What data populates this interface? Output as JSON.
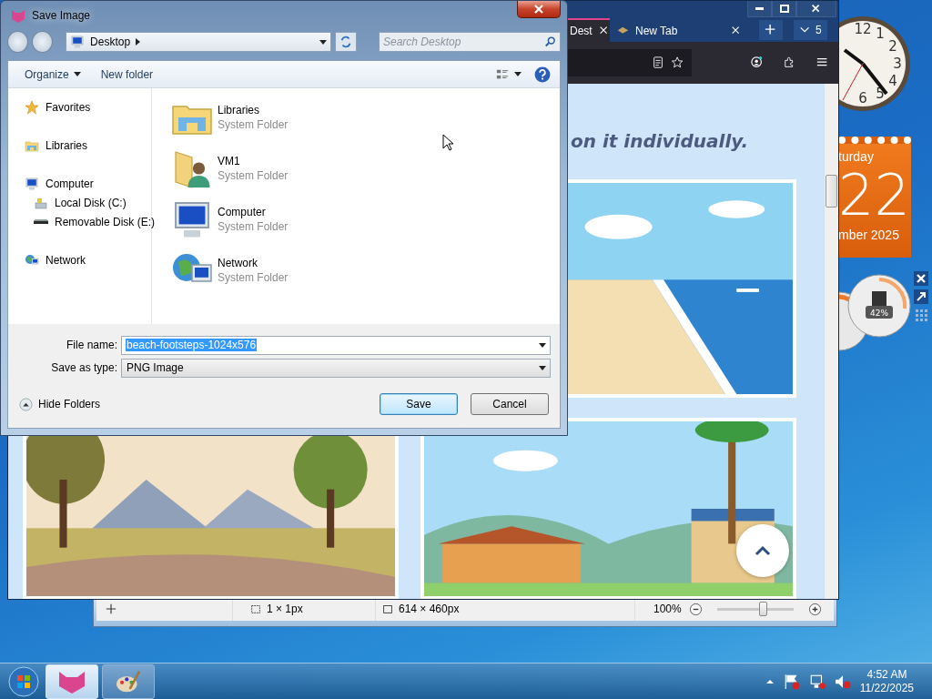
{
  "dialog": {
    "title": "Save Image",
    "address": "Desktop",
    "search": {
      "placeholder": "Search Desktop"
    },
    "toolbar": [
      "Organize",
      "New folder"
    ],
    "nav_tree": [
      {
        "label": "Favorites"
      },
      {
        "label": "Libraries"
      },
      {
        "label": "Computer",
        "children": [
          {
            "label": "Local Disk (C:)"
          },
          {
            "label": "Removable Disk (E:)"
          }
        ]
      },
      {
        "label": "Network"
      }
    ],
    "files": [
      {
        "name": "Libraries",
        "type": "System Folder"
      },
      {
        "name": "VM1",
        "type": "System Folder"
      },
      {
        "name": "Computer",
        "type": "System Folder"
      },
      {
        "name": "Network",
        "type": "System Folder"
      }
    ],
    "file_name": {
      "label": "File name:",
      "value": "beach-footsteps-1024x576",
      "highlighted": true
    },
    "save_as_type": {
      "label": "Save as type:",
      "value": "PNG Image"
    },
    "hide_folders": "Hide Folders",
    "buttons": [
      {
        "label": "Save",
        "default": true
      },
      {
        "label": "Cancel",
        "default": false
      }
    ]
  },
  "browser": {
    "tabs": [
      {
        "label": "Dest",
        "selected": true
      },
      {
        "label": "New Tab",
        "selected": false
      }
    ],
    "tab_count": "5",
    "heading": "on it individually."
  },
  "paint_status": {
    "selection": "1 × 1px",
    "size": "614 × 460px",
    "zoom": "100%",
    "level": 0.6
  },
  "gadgets": {
    "clock_numerals": [
      "12",
      "1",
      "2",
      "3",
      "4",
      "6",
      "5"
    ],
    "calendar": {
      "weekday": "turday",
      "day": "22",
      "month": "mber 2025"
    },
    "cpu": "42%"
  },
  "taskbar": {
    "apps": [
      {
        "kind": "browser",
        "selected": true
      },
      {
        "kind": "paint",
        "selected": false
      }
    ],
    "time": "4:52 AM",
    "date": "11/22/2025"
  }
}
